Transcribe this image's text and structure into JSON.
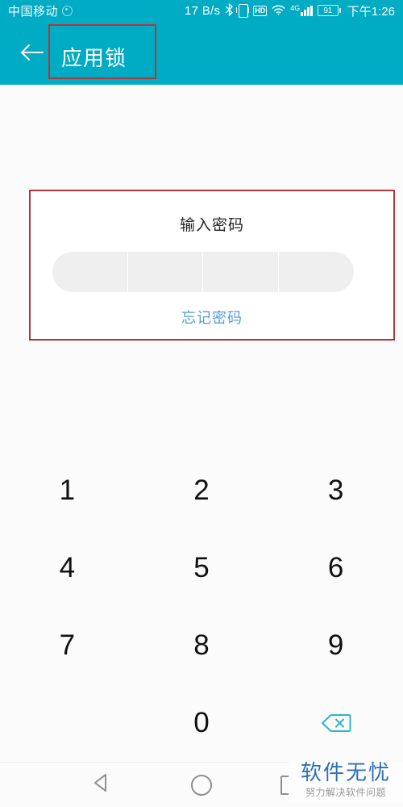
{
  "theme": {
    "accent": "#00abc4",
    "annotation": "#b0373c",
    "link": "#529bd8",
    "watermark_blue": "#2f6fb5",
    "pin_fill": "#efefef"
  },
  "status_bar": {
    "carrier": "中国移动",
    "carrier_icon": "circle-dot-icon",
    "network_speed": "17 B/s",
    "icons": [
      {
        "name": "bluetooth-icon",
        "glyph": "✻"
      },
      {
        "name": "vibrate-icon",
        "glyph": ""
      },
      {
        "name": "hd-voice-icon",
        "glyph": "HD"
      },
      {
        "name": "wifi-icon",
        "glyph": ""
      },
      {
        "name": "signal-4g-icon",
        "glyph": "4G"
      },
      {
        "name": "signal-bars-icon",
        "glyph": ""
      },
      {
        "name": "battery-icon",
        "glyph": ""
      }
    ],
    "hd_label": "HD",
    "network_gen": "4G",
    "battery_level": "91",
    "time": "下午1:26"
  },
  "app_bar": {
    "back_icon": "arrow-left-icon",
    "title": "应用锁"
  },
  "password_panel": {
    "label": "输入密码",
    "pin_length": 4,
    "pin_values": [
      "",
      "",
      "",
      ""
    ],
    "forgot_link": "忘记密码"
  },
  "keypad": {
    "keys": [
      {
        "name": "key-1",
        "label": "1",
        "type": "digit"
      },
      {
        "name": "key-2",
        "label": "2",
        "type": "digit"
      },
      {
        "name": "key-3",
        "label": "3",
        "type": "digit"
      },
      {
        "name": "key-4",
        "label": "4",
        "type": "digit"
      },
      {
        "name": "key-5",
        "label": "5",
        "type": "digit"
      },
      {
        "name": "key-6",
        "label": "6",
        "type": "digit"
      },
      {
        "name": "key-7",
        "label": "7",
        "type": "digit"
      },
      {
        "name": "key-8",
        "label": "8",
        "type": "digit"
      },
      {
        "name": "key-9",
        "label": "9",
        "type": "digit"
      },
      {
        "name": "key-blank",
        "label": "",
        "type": "empty"
      },
      {
        "name": "key-0",
        "label": "0",
        "type": "digit"
      },
      {
        "name": "key-backspace",
        "label": "",
        "type": "backspace-icon"
      }
    ]
  },
  "nav_bar": {
    "back": "nav-back-icon",
    "home": "nav-home-icon",
    "recents": "nav-recents-icon"
  },
  "watermark": {
    "title": "软件无忧",
    "subtitle": "努力解决软件问题"
  },
  "annotations": [
    {
      "name": "annotation-title-box",
      "target": "app-bar-title"
    },
    {
      "name": "annotation-password-panel-box",
      "target": "password-panel"
    }
  ]
}
